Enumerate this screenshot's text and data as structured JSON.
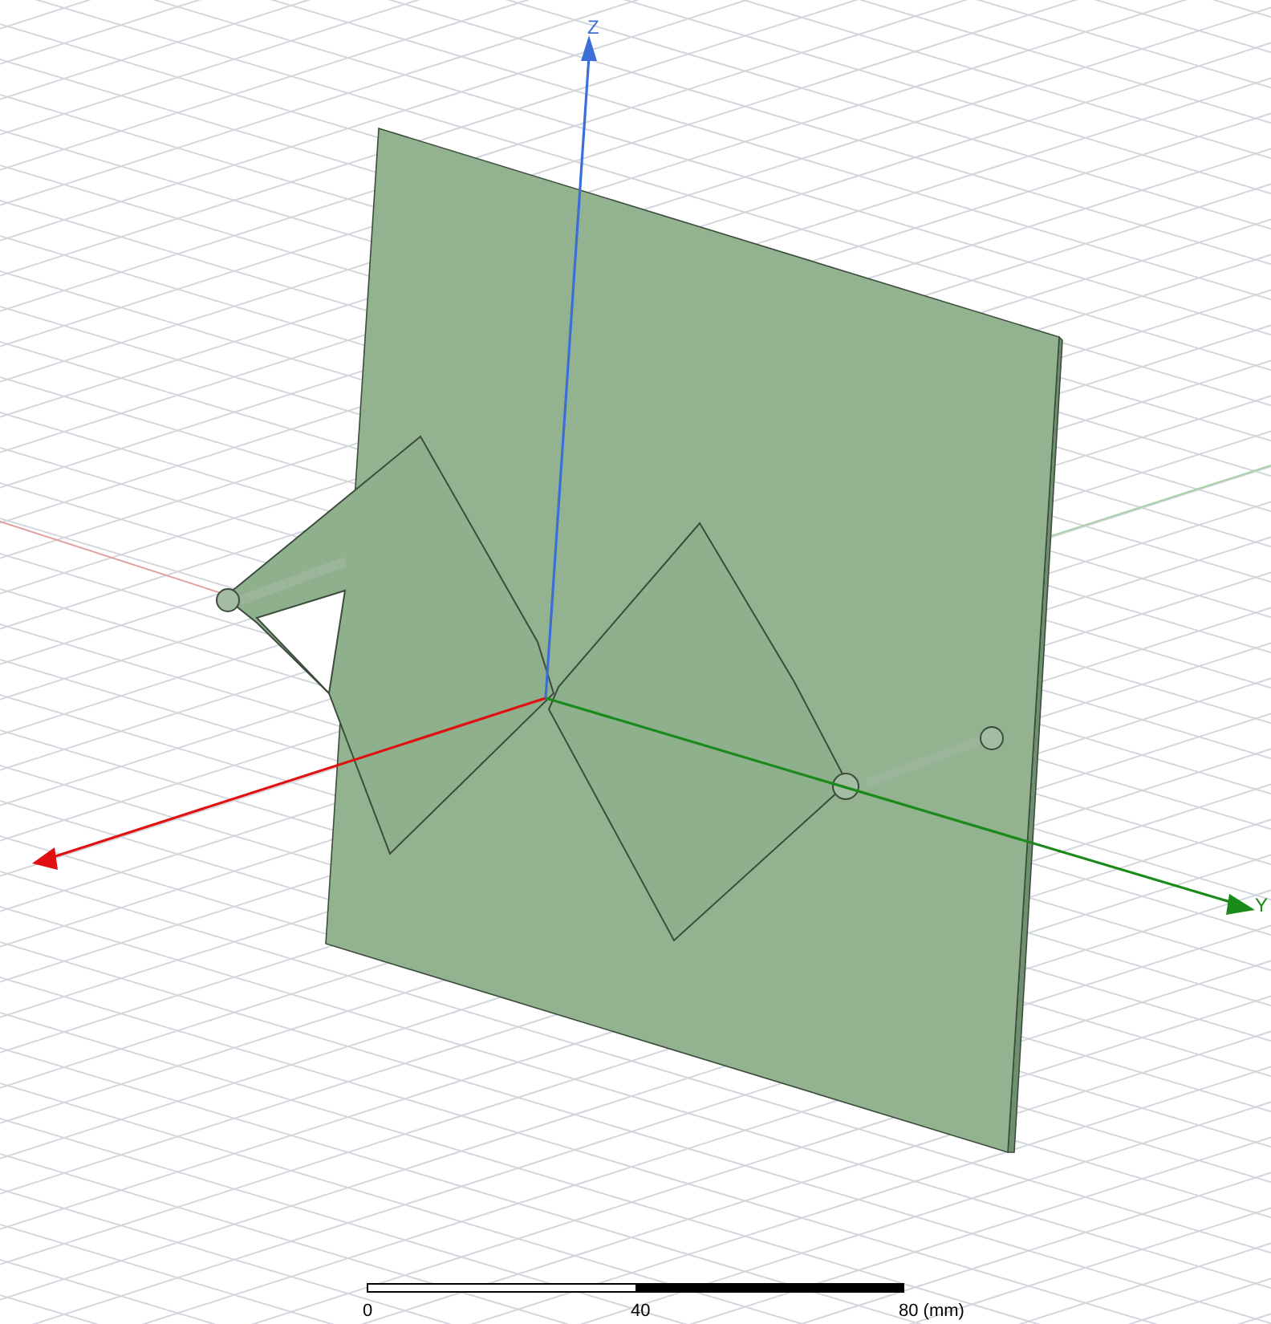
{
  "axis_labels": [
    {
      "kind": "z",
      "label": "Z"
    },
    {
      "kind": "y",
      "label": "Y"
    }
  ],
  "scale_bar": {
    "ticks": [
      "0",
      "40",
      "80 (mm)"
    ]
  }
}
